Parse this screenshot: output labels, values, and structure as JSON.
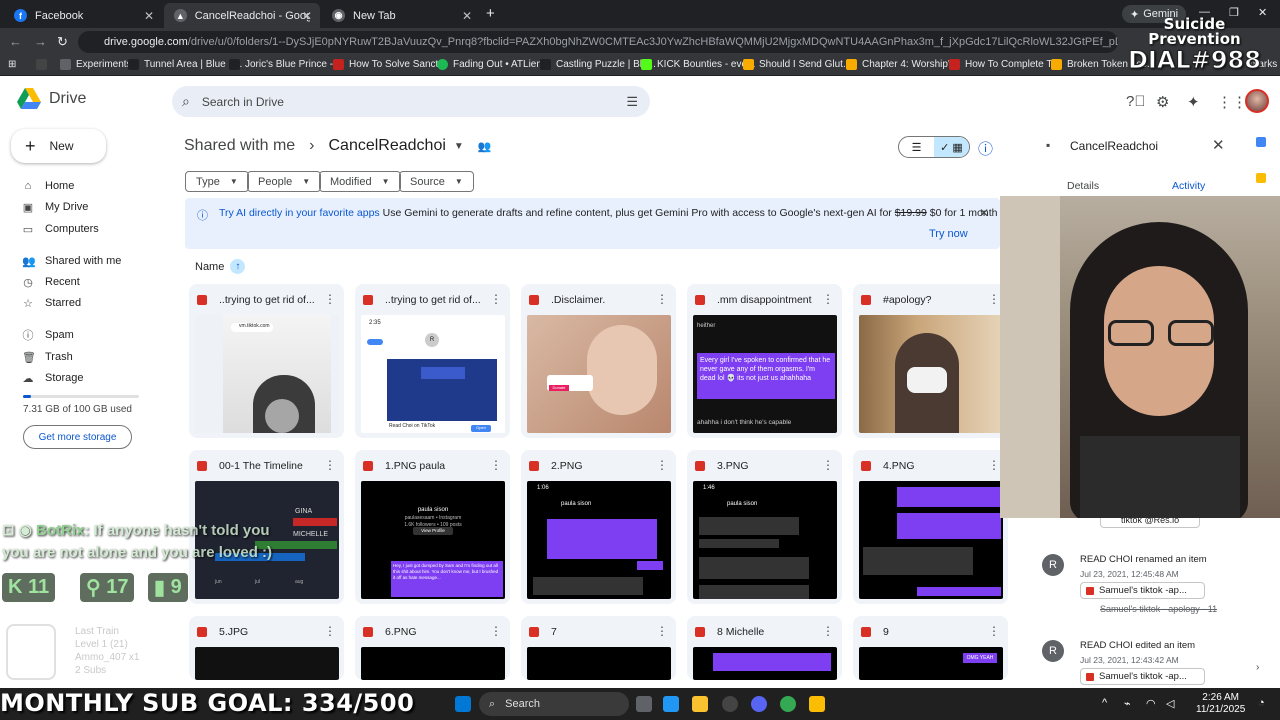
{
  "browser": {
    "tabs": [
      {
        "label": "Facebook",
        "active": false
      },
      {
        "label": "CancelReadchoi - Google Drive",
        "active": true
      },
      {
        "label": "New Tab",
        "active": false
      }
    ],
    "gemini_chip": "Gemini",
    "url_host": "drive.google.com",
    "url_path": "/drive/u/0/folders/1--DySJjE0pNYRuwT2BJaVuuzQv_Pnrq8?fbclid=PAZXh0bgNhZW0CMTEAc3J0YwZhcHBfaWQMMjU2MjgxMDQwNTU4AAGnPhax3m_f_jXpGdc17LilQcRloWL32JGtPEf_pDCKU3Ob_hdI7MDtrqLWUzw_aem_NuC8...",
    "bookmarks": [
      "Experiments",
      "Tunnel Area | Blue P...",
      "Joric's Blue Prince -...",
      "How To Solve Sanct...",
      "Fading Out • ATLien...",
      "Castling Puzzle | Blu...",
      "KICK Bounties - eve...",
      "Should I Send Glut...",
      "Chapter 4: Worship'...",
      "How To Complete T...",
      "Broken Token Loc..."
    ],
    "bookmarks_tail": "marks"
  },
  "drive": {
    "logo_text": "Drive",
    "search_placeholder": "Search in Drive",
    "new_label": "New",
    "sidebar": [
      {
        "label": "Home",
        "icon": "home-icon"
      },
      {
        "label": "My Drive",
        "icon": "my-drive-icon"
      },
      {
        "label": "Computers",
        "icon": "computers-icon"
      },
      {
        "label": "Shared with me",
        "icon": "shared-icon"
      },
      {
        "label": "Recent",
        "icon": "recent-icon"
      },
      {
        "label": "Starred",
        "icon": "star-icon"
      },
      {
        "label": "Spam",
        "icon": "spam-icon"
      },
      {
        "label": "Trash",
        "icon": "trash-icon"
      },
      {
        "label": "Storage",
        "icon": "cloud-icon"
      }
    ],
    "storage_used": "7.31 GB of 100 GB used",
    "storage_fraction": 0.0731,
    "get_storage": "Get more storage",
    "breadcrumb_parent": "Shared with me",
    "breadcrumb_current": "CancelReadchoi",
    "filters": [
      "Type",
      "People",
      "Modified",
      "Source"
    ],
    "banner": {
      "lead": "Try AI directly in your favorite apps",
      "body": " Use Gemini to generate drafts and refine content, plus get Gemini Pro with access to Google's next-gen AI for ",
      "old_price": "$19.99",
      "offer": " $0 for 1 month",
      "action": "Try now"
    },
    "sort_label": "Name",
    "files": [
      {
        "name": "..trying to get rid of..."
      },
      {
        "name": "..trying to get rid of..."
      },
      {
        "name": ".Disclaimer."
      },
      {
        "name": ".mm disappointment"
      },
      {
        "name": "#apology?"
      },
      {
        "name": "00-1 The Timeline"
      },
      {
        "name": "1.PNG paula"
      },
      {
        "name": "2.PNG"
      },
      {
        "name": "3.PNG"
      },
      {
        "name": "4.PNG"
      },
      {
        "name": "5.JPG"
      },
      {
        "name": "6.PNG"
      },
      {
        "name": "7"
      },
      {
        "name": "8 Michelle"
      },
      {
        "name": "9"
      }
    ],
    "thumb_texts": {
      "disappointment": "Every girl I've spoken to confirmed that he never gave any of them orgasms. I'm dead lol 💀 its not just us ahahhaha",
      "disappointment_tail": "ahahha i don't think he's capable",
      "timeline_gina": "GINA",
      "timeline_michelle": "MICHELLE",
      "timeline_months": [
        "jun",
        "jul",
        "aug"
      ],
      "paula_name": "paula sison",
      "paula_handle": "paulasesaam • Instagram",
      "paula_followers": "1.6K followers • 109 posts",
      "view_profile": "View Profile",
      "paula_msg": "Hey, I just got dumped by Sam and I'm finding out all this shit about him. You don't know me, but I brushed it off as hate message...",
      "donate": "Donate",
      "read_choi": "Read Choi on TikTok",
      "open": "Open",
      "tiktok": "vm.tiktok.com",
      "clock_235": "2:35",
      "clock_106": "1:06",
      "clock_146": "1:46",
      "omg_yeah": "OMG YEAH"
    }
  },
  "details_panel": {
    "title": "CancelReadchoi",
    "tabs": [
      "Details",
      "Activity"
    ],
    "top_chip": "tiktok @Res.io",
    "activities": [
      {
        "avatar": "R",
        "who": "READ CHOI renamed an item",
        "when": "Jul 23, 2021, 12:45:48 AM",
        "file": "Samuel's tiktok -ap...",
        "old": "Samuel's tiktok - apology - 11"
      },
      {
        "avatar": "R",
        "who": "READ CHOI edited an item",
        "when": "Jul 23, 2021, 12:43:42 AM",
        "file": "Samuel's tiktok -ap..."
      }
    ]
  },
  "stream": {
    "title_l1": "Suicide",
    "title_l2": "Prevention",
    "title_l3": "DIAL#988",
    "chat_name": "BotRix",
    "chat_msg": ": If anyone hasn't told you",
    "chat_msg2": "you are not alone and you are loved :)",
    "stat_k": "11",
    "stat_up": "17",
    "stat_bars": "9",
    "last_train": [
      "Last Train",
      "Level 1 (21)",
      "Ammo_407 x1",
      "2 Subs"
    ],
    "sub_goal": "MONTHLY SUB GOAL: 334/500"
  },
  "taskbar": {
    "search": "Search",
    "time": "2:26 AM",
    "date": "11/21/2025"
  }
}
